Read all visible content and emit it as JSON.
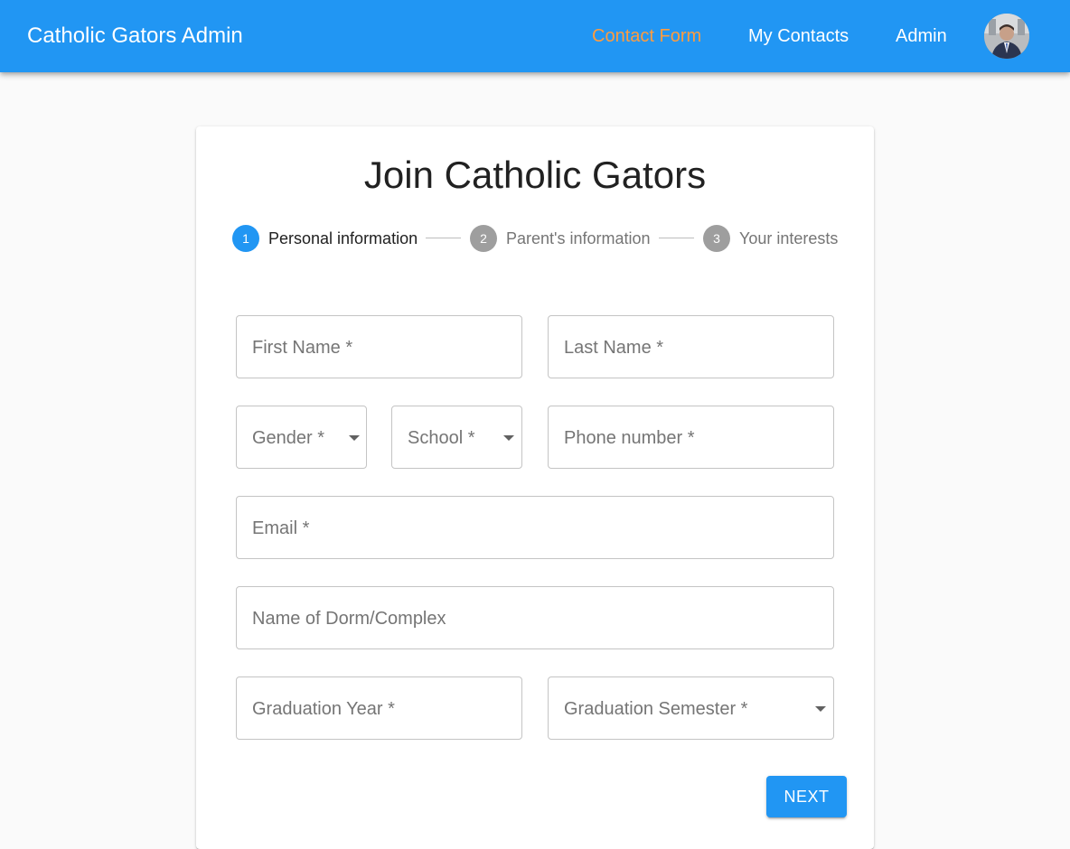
{
  "app": {
    "title": "Catholic Gators Admin"
  },
  "nav": {
    "items": [
      {
        "label": "Contact Form",
        "active": true
      },
      {
        "label": "My Contacts",
        "active": false
      },
      {
        "label": "Admin",
        "active": false
      }
    ],
    "avatar_icon": "user-avatar"
  },
  "form": {
    "title": "Join Catholic Gators",
    "steps": [
      {
        "number": "1",
        "label": "Personal information",
        "active": true
      },
      {
        "number": "2",
        "label": "Parent's information",
        "active": false
      },
      {
        "number": "3",
        "label": "Your interests",
        "active": false
      }
    ],
    "fields": {
      "first_name": {
        "placeholder": "First Name *",
        "value": ""
      },
      "last_name": {
        "placeholder": "Last Name *",
        "value": ""
      },
      "gender": {
        "placeholder": "Gender *",
        "value": ""
      },
      "school": {
        "placeholder": "School *",
        "value": ""
      },
      "phone": {
        "placeholder": "Phone number *",
        "value": ""
      },
      "email": {
        "placeholder": "Email *",
        "value": ""
      },
      "dorm": {
        "placeholder": "Name of Dorm/Complex",
        "value": ""
      },
      "grad_year": {
        "placeholder": "Graduation Year *",
        "value": ""
      },
      "grad_semester": {
        "placeholder": "Graduation Semester *",
        "value": ""
      }
    },
    "next_label": "NEXT"
  },
  "colors": {
    "primary": "#2196f3",
    "nav_active": "#ff9c3e",
    "step_inactive": "#9e9e9e",
    "page_background": "#fafafa"
  }
}
